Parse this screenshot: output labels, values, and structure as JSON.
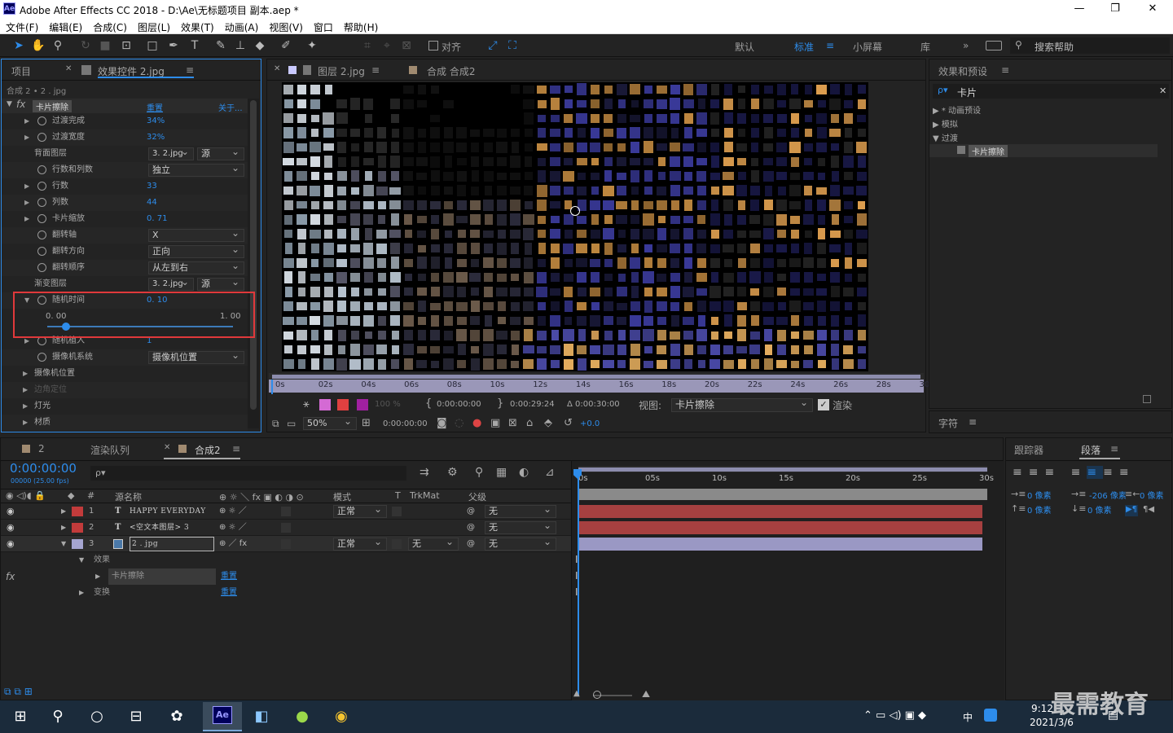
{
  "window": {
    "app_logo": "Ae",
    "title": "Adobe After Effects CC 2018 - D:\\Ae\\无标题项目 副本.aep *",
    "min": "—",
    "max": "❐",
    "close": "✕"
  },
  "menu": [
    "文件(F)",
    "编辑(E)",
    "合成(C)",
    "图层(L)",
    "效果(T)",
    "动画(A)",
    "视图(V)",
    "窗口",
    "帮助(H)"
  ],
  "toolbar": {
    "snap_label": "对齐",
    "workspaces": [
      "默认",
      "标准",
      "小屏幕",
      "库"
    ],
    "active_workspace": "标准",
    "search_help": "搜索帮助"
  },
  "left_panel": {
    "tab_project": "项目",
    "tab_effects": "效果控件 2.jpg",
    "breadcrumb": "合成 2 • 2 . jpg",
    "effect_name": "卡片擦除",
    "reset": "重置",
    "about": "关于...",
    "props": [
      {
        "label": "过渡完成",
        "value": "34%"
      },
      {
        "label": "过渡宽度",
        "value": "32%"
      },
      {
        "label": "背面图层",
        "dd1": "3. 2.jpg",
        "dd2": "源"
      },
      {
        "label": "行数和列数",
        "dd1": "独立"
      },
      {
        "label": "行数",
        "value": "33"
      },
      {
        "label": "列数",
        "value": "44"
      },
      {
        "label": "卡片缩放",
        "value": "0. 71"
      },
      {
        "label": "翻转轴",
        "dd1": "X"
      },
      {
        "label": "翻转方向",
        "dd1": "正向"
      },
      {
        "label": "翻转顺序",
        "dd1": "从左到右"
      },
      {
        "label": "渐变图层",
        "dd1": "3. 2.jpg",
        "dd2": "源"
      },
      {
        "label": "随机时间",
        "value": "0. 10"
      },
      {
        "label": "随机植入",
        "value": "1"
      },
      {
        "label": "摄像机系统",
        "dd1": "摄像机位置"
      },
      {
        "label": "摄像机位置"
      },
      {
        "label": "边角定位"
      },
      {
        "label": "灯光"
      },
      {
        "label": "材质"
      }
    ],
    "slider_min": "0. 00",
    "slider_max": "1. 00",
    "slider_value": 0.1
  },
  "viewer": {
    "tab_layer": "图层 2.jpg",
    "tab_comp": "合成 合成2",
    "ruler_ticks": [
      "0s",
      "02s",
      "04s",
      "06s",
      "08s",
      "10s",
      "12s",
      "14s",
      "16s",
      "18s",
      "20s",
      "22s",
      "24s",
      "26s",
      "28s",
      "30s"
    ],
    "in_time": "0:00:00:00",
    "out_time": "0:00:29:24",
    "duration": "Δ 0:00:30:00",
    "opacity": "100 %",
    "view_label": "视图:",
    "view_value": "卡片擦除",
    "render_label": "渲染",
    "zoom": "50%",
    "timecode": "0:00:00:00",
    "exposure": "+0.0"
  },
  "effects_presets": {
    "title": "效果和预设",
    "search": "卡片",
    "tree": [
      "* 动画预设",
      "模拟",
      "过渡"
    ],
    "item": "卡片擦除"
  },
  "character": {
    "title": "字符"
  },
  "timeline": {
    "tab_2": "2",
    "tab_render": "渲染队列",
    "tab_comp": "合成2",
    "timecode": "0:00:00:00",
    "fps": "00000 (25.00 fps)",
    "search_placeholder": "ρ▾",
    "col_source": "源名称",
    "col_mode": "模式",
    "col_t": "T",
    "col_trkmat": "TrkMat",
    "col_parent": "父级",
    "ticks": [
      "0s",
      "05s",
      "10s",
      "15s",
      "20s",
      "25s",
      "30s"
    ],
    "layers": [
      {
        "num": "1",
        "type": "T",
        "name": "HAPPY EVERYDAY",
        "mode": "正常",
        "parent": "无",
        "color": "#c23b3b"
      },
      {
        "num": "2",
        "type": "T",
        "name": "<空文本图层> 3",
        "mode": "",
        "parent": "无",
        "color": "#c23b3b"
      },
      {
        "num": "3",
        "type": "",
        "name": "2 . jpg",
        "mode": "正常",
        "trkmat": "无",
        "parent": "无",
        "color": "#a5a5d0"
      }
    ],
    "sub_effects": "效果",
    "sub_card": "卡片擦除",
    "sub_reset": "重置",
    "sub_transform": "变换",
    "sub_reset2": "重置"
  },
  "paragraph": {
    "tab_tracker": "跟踪器",
    "tab_paragraph": "段落",
    "indent_left": "0 像素",
    "indent_first": "-206 像素",
    "indent_right": "0 像素",
    "space_before": "0 像素",
    "space_after": "0 像素"
  },
  "taskbar": {
    "time": "9:12",
    "date": "2021/3/6",
    "ime": "中",
    "app_logo": "Ae"
  },
  "watermark": "最需教育"
}
